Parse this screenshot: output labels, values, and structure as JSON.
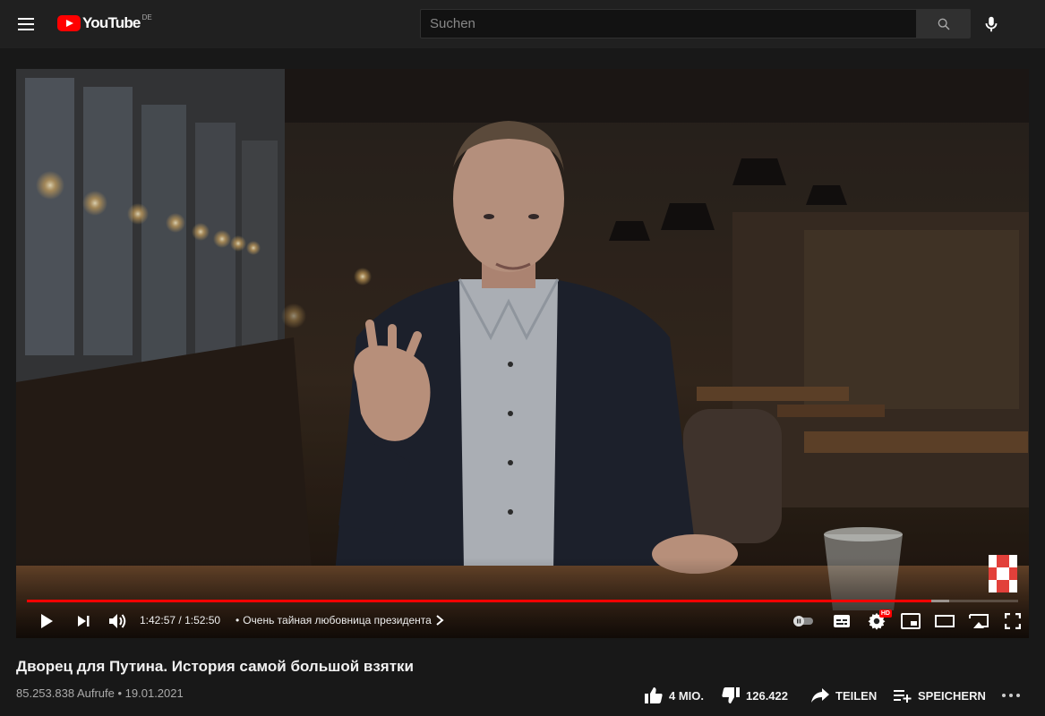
{
  "header": {
    "logo_text": "YouTube",
    "country_code": "DE",
    "search_placeholder": "Suchen"
  },
  "player": {
    "current_time": "1:42:57",
    "duration": "1:52:50",
    "time_separator": " / ",
    "chapter_bullet": "•",
    "chapter_title": "Очень тайная любовница президента",
    "progress_played_fraction": 0.9124,
    "progress_loaded_fraction": 0.93,
    "hd_badge": "HD"
  },
  "video": {
    "title": "Дворец для Путина. История самой большой взятки",
    "views": "85.253.838 Aufrufe",
    "meta_separator": " • ",
    "date": "19.01.2021"
  },
  "actions": {
    "likes": "4 MIO.",
    "dislikes": "126.422",
    "share": "TEILEN",
    "save": "SPEICHERN"
  },
  "colors": {
    "brand_red": "#ff0000",
    "background": "#181818",
    "topbar": "#202020"
  }
}
